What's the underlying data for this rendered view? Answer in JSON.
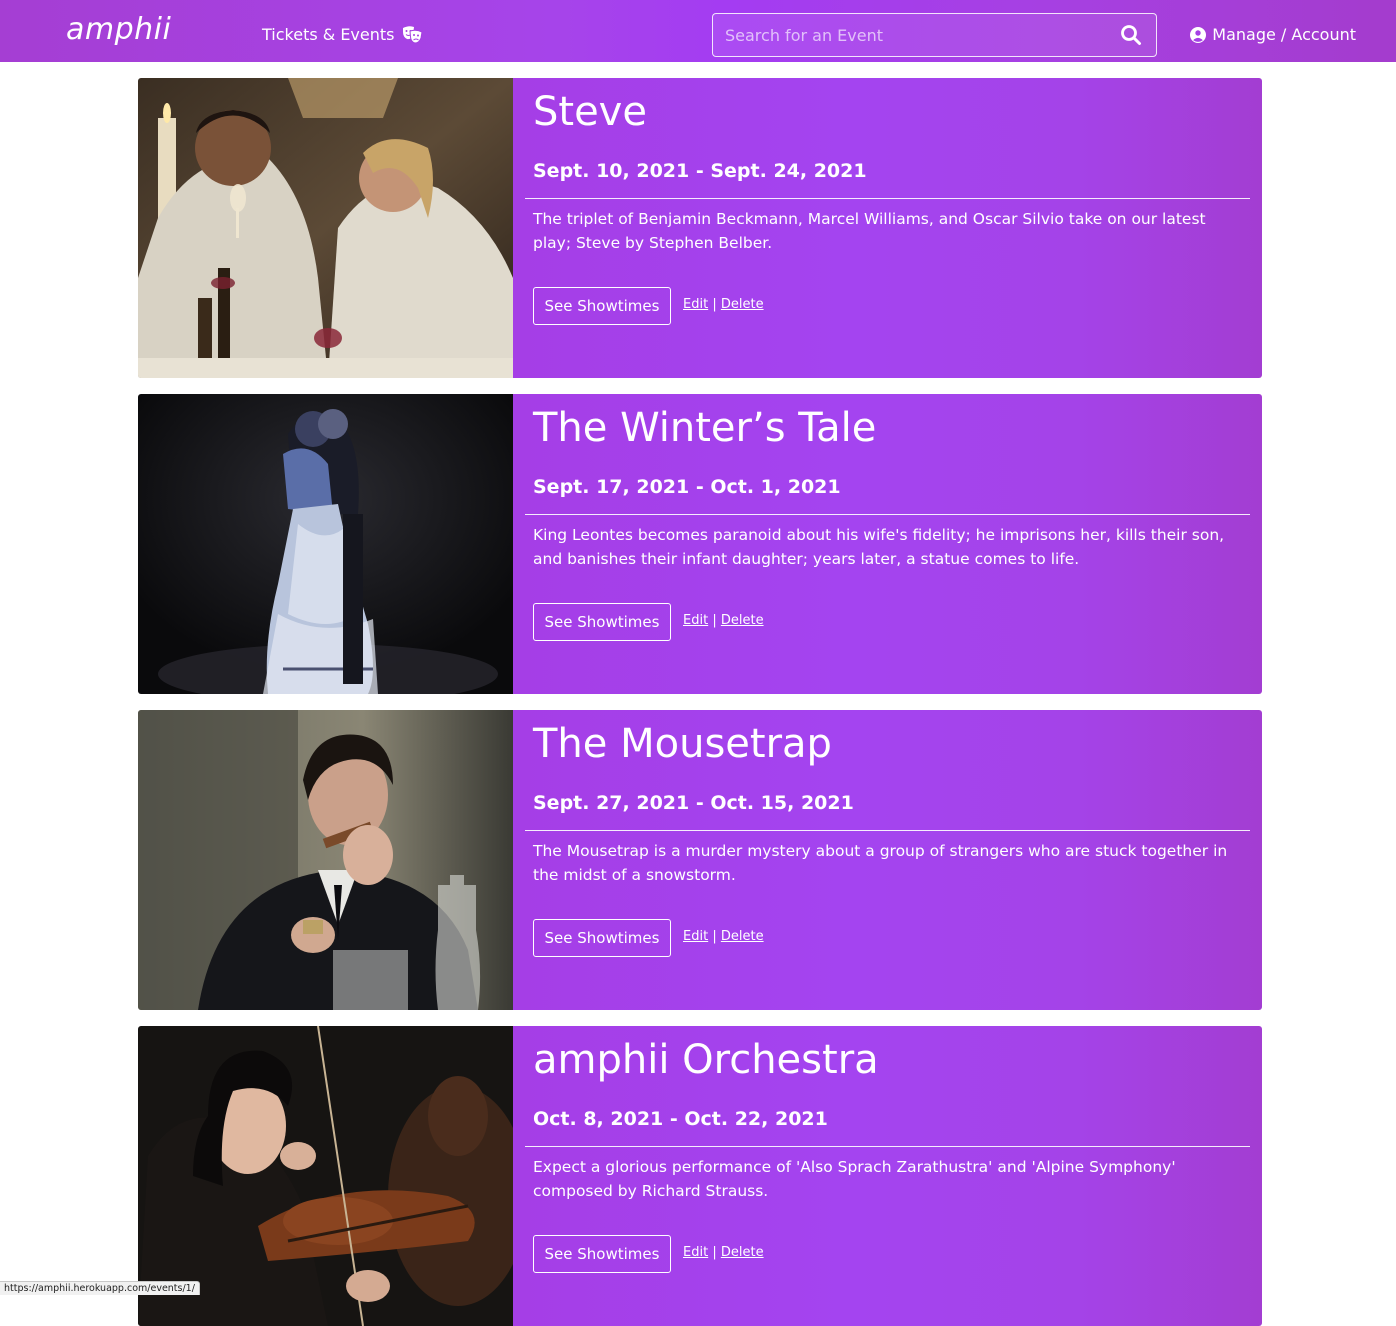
{
  "navbar": {
    "brand": "amphii",
    "tickets_label": "Tickets & Events",
    "search_placeholder": "Search for an Event",
    "account_label": "Manage / Account"
  },
  "events": [
    {
      "title": "Steve",
      "dates": "Sept. 10, 2021 - Sept. 24, 2021",
      "description": "The triplet of Benjamin Beckmann, Marcel Williams, and Oscar Silvio take on our latest play; Steve by Stephen Belber.",
      "showtimes_label": "See Showtimes",
      "edit_label": "Edit",
      "separator": "|",
      "delete_label": "Delete"
    },
    {
      "title": "The Winter’s Tale",
      "dates": "Sept. 17, 2021 - Oct. 1, 2021",
      "description": "King Leontes becomes paranoid about his wife's fidelity; he imprisons her, kills their son, and banishes their infant daughter; years later, a statue comes to life.",
      "showtimes_label": "See Showtimes",
      "edit_label": "Edit",
      "separator": "|",
      "delete_label": "Delete"
    },
    {
      "title": "The Mousetrap",
      "dates": "Sept. 27, 2021 - Oct. 15, 2021",
      "description": "The Mousetrap is a murder mystery about a group of strangers who are stuck together in the midst of a snowstorm.",
      "showtimes_label": "See Showtimes",
      "edit_label": "Edit",
      "separator": "|",
      "delete_label": "Delete"
    },
    {
      "title": "amphii Orchestra",
      "dates": "Oct. 8, 2021 - Oct. 22, 2021",
      "description": "Expect a glorious performance of 'Also Sprach Zarathustra' and 'Alpine Symphony' composed by Richard Strauss.",
      "showtimes_label": "See Showtimes",
      "edit_label": "Edit",
      "separator": "|",
      "delete_label": "Delete"
    }
  ],
  "status_bar": {
    "url": "https://amphii.herokuapp.com/events/1/"
  },
  "colors": {
    "accent": "#a444f0",
    "text_on_accent": "#ffffff"
  },
  "icons": {
    "tickets": "theater-masks-icon",
    "search": "search-icon",
    "account": "user-circle-icon"
  }
}
